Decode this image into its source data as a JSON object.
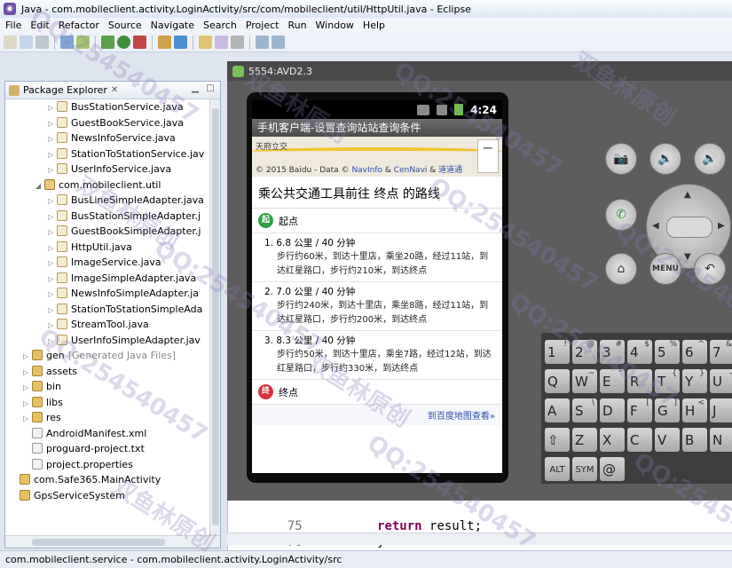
{
  "window": {
    "title": "Java - com.mobileclient.activity.LoginActivity/src/com/mobileclient/util/HttpUtil.java - Eclipse"
  },
  "menu": [
    "File",
    "Edit",
    "Refactor",
    "Source",
    "Navigate",
    "Search",
    "Project",
    "Run",
    "Window",
    "Help"
  ],
  "package_explorer": {
    "tab_label": "Package Explorer",
    "rows": [
      {
        "indent": 3,
        "icon": "java-file",
        "label": "BusStationService.java"
      },
      {
        "indent": 3,
        "icon": "java-file",
        "label": "GuestBookService.java"
      },
      {
        "indent": 3,
        "icon": "java-file",
        "label": "NewsInfoService.java"
      },
      {
        "indent": 3,
        "icon": "java-file",
        "label": "StationToStationService.jav"
      },
      {
        "indent": 3,
        "icon": "java-file",
        "label": "UserInfoService.java"
      },
      {
        "indent": 2,
        "icon": "package",
        "label": "com.mobileclient.util",
        "expanded": true
      },
      {
        "indent": 3,
        "icon": "java-file",
        "label": "BusLineSimpleAdapter.java"
      },
      {
        "indent": 3,
        "icon": "java-file",
        "label": "BusStationSimpleAdapter.j"
      },
      {
        "indent": 3,
        "icon": "java-file",
        "label": "GuestBookSimpleAdapter.j"
      },
      {
        "indent": 3,
        "icon": "java-file",
        "label": "HttpUtil.java"
      },
      {
        "indent": 3,
        "icon": "java-file",
        "label": "ImageService.java"
      },
      {
        "indent": 3,
        "icon": "java-file",
        "label": "ImageSimpleAdapter.java"
      },
      {
        "indent": 3,
        "icon": "java-file",
        "label": "NewsInfoSimpleAdapter.ja"
      },
      {
        "indent": 3,
        "icon": "java-file",
        "label": "StationToStationSimpleAda"
      },
      {
        "indent": 3,
        "icon": "java-file",
        "label": "StreamTool.java"
      },
      {
        "indent": 3,
        "icon": "java-file",
        "label": "UserInfoSimpleAdapter.jav"
      },
      {
        "indent": 1,
        "icon": "folder",
        "label": "gen",
        "suffix": "[Generated Java Files]"
      },
      {
        "indent": 1,
        "icon": "folder",
        "label": "assets"
      },
      {
        "indent": 1,
        "icon": "folder",
        "label": "bin"
      },
      {
        "indent": 1,
        "icon": "folder",
        "label": "libs"
      },
      {
        "indent": 1,
        "icon": "folder",
        "label": "res"
      },
      {
        "indent": 1,
        "icon": "xml-file",
        "label": "AndroidManifest.xml",
        "leaf": true
      },
      {
        "indent": 1,
        "icon": "text-file",
        "label": "proguard-project.txt",
        "leaf": true
      },
      {
        "indent": 1,
        "icon": "text-file",
        "label": "project.properties",
        "leaf": true
      },
      {
        "indent": 0,
        "icon": "project",
        "label": "com.Safe365.MainActivity",
        "leaf": true
      },
      {
        "indent": 0,
        "icon": "project",
        "label": "GpsServiceSystem",
        "leaf": true
      }
    ]
  },
  "emulator": {
    "title": "5554:AVD2.3",
    "status_time": "4:24",
    "app_title": "手机客户端-设置查询站站查询条件",
    "map_place": "天府立交",
    "map_copyright": "© 2015 Baidu - Data ©",
    "map_copyright_links": [
      "NavInfo",
      "CenNavi",
      "道道通"
    ],
    "route_heading": "乘公共交通工具前往 终点 的路线",
    "start_badge": "起",
    "start_label": "起点",
    "end_badge": "终",
    "end_label": "终点",
    "plans": [
      {
        "summary": "1. 6.8 公里 / 40 分钟",
        "detail": "步行约60米，到达十里店，乘坐20路，经过11站，到达红星路口，步行约210米，到达终点"
      },
      {
        "summary": "2. 7.0 公里 / 40 分钟",
        "detail": "步行约240米，到达十里店，乘坐8路，经过11站，到达红星路口，步行约200米，到达终点"
      },
      {
        "summary": "3. 8.3 公里 / 40 分钟",
        "detail": "步行约50米，到达十里店，乘坐7路，经过12站，到达红星路口，步行约330米，到达终点"
      }
    ],
    "more_link": "到百度地图查看»",
    "menu_key": "MENU"
  },
  "keyboard": {
    "row1": [
      {
        "k": "1",
        "s": "!"
      },
      {
        "k": "2",
        "s": "@"
      },
      {
        "k": "3",
        "s": "#"
      },
      {
        "k": "4",
        "s": "$"
      },
      {
        "k": "5",
        "s": "%"
      },
      {
        "k": "6",
        "s": "^"
      },
      {
        "k": "7",
        "s": "&"
      }
    ],
    "row2": [
      {
        "k": "Q",
        "s": ""
      },
      {
        "k": "W",
        "s": "~"
      },
      {
        "k": "E",
        "s": "\""
      },
      {
        "k": "R",
        "s": ""
      },
      {
        "k": "T",
        "s": "{"
      },
      {
        "k": "Y",
        "s": "}"
      },
      {
        "k": "U",
        "s": "-"
      }
    ],
    "row3": [
      {
        "k": "A",
        "s": ""
      },
      {
        "k": "S",
        "s": "\\"
      },
      {
        "k": "D",
        "s": ""
      },
      {
        "k": "F",
        "s": "["
      },
      {
        "k": "G",
        "s": "]"
      },
      {
        "k": "H",
        "s": "<"
      },
      {
        "k": "J",
        "s": ""
      }
    ],
    "row4": [
      {
        "k": "⇧",
        "s": ""
      },
      {
        "k": "Z",
        "s": ""
      },
      {
        "k": "X",
        "s": ""
      },
      {
        "k": "C",
        "s": ""
      },
      {
        "k": "V",
        "s": ""
      },
      {
        "k": "B",
        "s": ""
      },
      {
        "k": "N",
        "s": ""
      }
    ],
    "row5": [
      {
        "k": "ALT",
        "s": ""
      },
      {
        "k": "SYM",
        "s": ""
      },
      {
        "k": "@",
        "s": ""
      }
    ]
  },
  "editor": {
    "lines": [
      {
        "num": "75",
        "code_kw": "return",
        "code": " result;"
      },
      {
        "num": "76",
        "code_kw": "",
        "code": "}"
      }
    ]
  },
  "status_bar": {
    "text": "com.mobileclient.service - com.mobileclient.activity.LoginActivity/src"
  },
  "watermark": {
    "text": "QQ:254540457",
    "text2": "双鱼林原创"
  },
  "colors": {
    "accent": "#6cc43a",
    "start": "#2fa247",
    "end": "#d7323b",
    "link": "#2d4fa8"
  }
}
